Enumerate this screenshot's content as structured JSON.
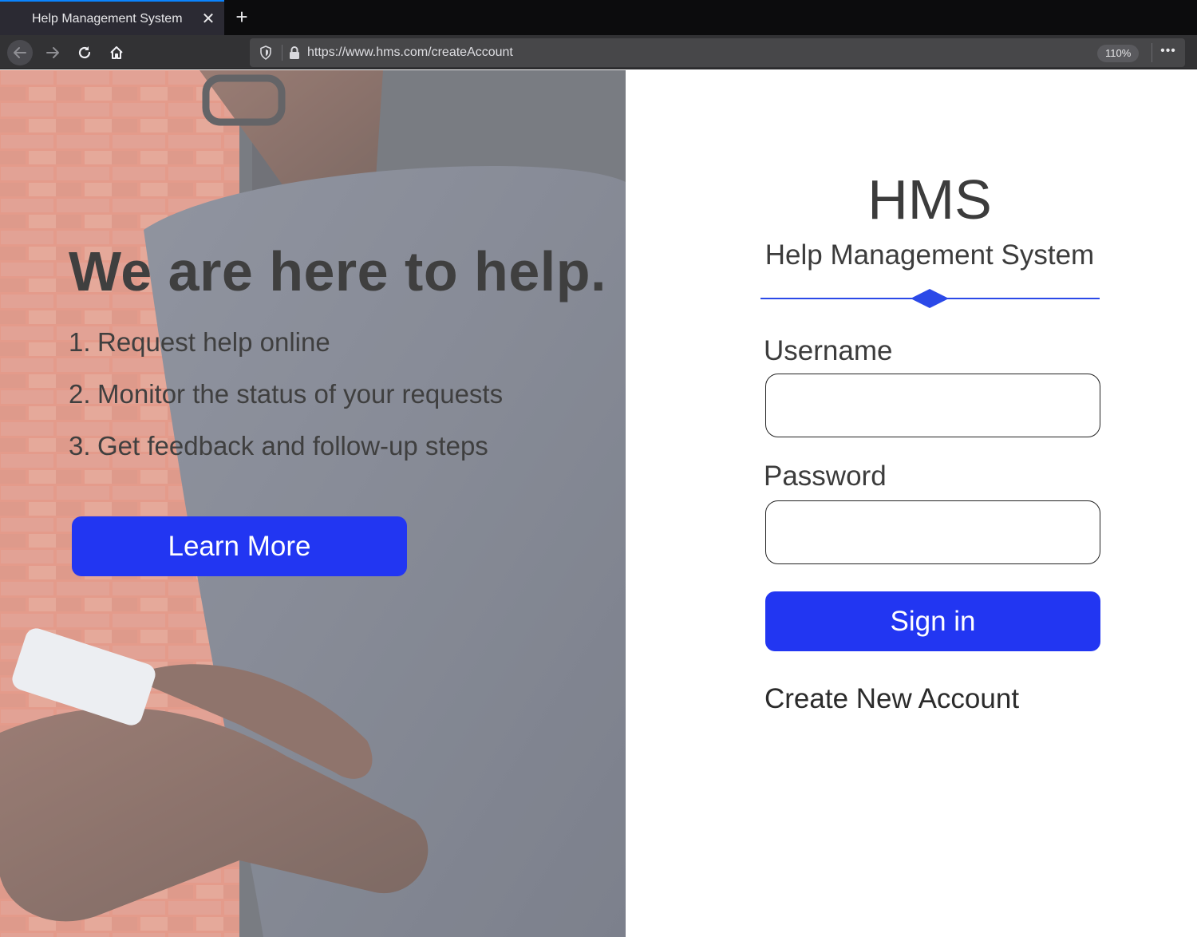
{
  "browser": {
    "tab_title": "Help Management System",
    "tab_close_icon": "close-icon",
    "new_tab_icon": "plus-icon",
    "url": "https://www.hms.com/createAccount",
    "zoom": "110%",
    "more_icon": "ellipsis-icon"
  },
  "hero": {
    "title": "We are here to help.",
    "steps": [
      {
        "num": "1.",
        "text": "Request help online"
      },
      {
        "num": "2.",
        "text": "Monitor the status of your requests"
      },
      {
        "num": "3.",
        "text": "Get feedback and follow-up steps"
      }
    ],
    "button_label": "Learn More"
  },
  "form": {
    "brand": "HMS",
    "brand_sub": "Help Management System",
    "username_label": "Username",
    "username_value": "",
    "password_label": "Password",
    "password_value": "",
    "signin_label": "Sign in",
    "create_account_label": "Create New Account"
  },
  "colors": {
    "accent": "#2236f2",
    "divider": "#2b49e8",
    "text": "#3c3c3c",
    "chrome_dark": "#0c0c0d",
    "chrome_bar": "#323234"
  }
}
